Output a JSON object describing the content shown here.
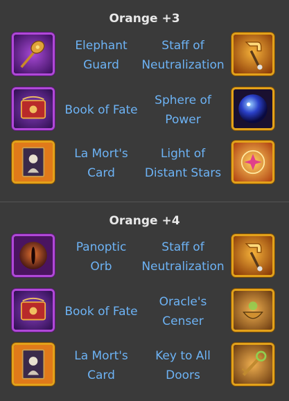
{
  "sections": [
    {
      "title": "Orange +3",
      "rows": [
        {
          "left": {
            "name": "Elephant Guard",
            "line1": "Elephant",
            "line2": "Guard",
            "icon": "elephant-guard-icon",
            "frame": "purple"
          },
          "right": {
            "name": "Staff of Neutralization",
            "line1": "Staff of",
            "line2": "Neutralization",
            "icon": "staff-of-neutralization-icon",
            "frame": "gold"
          }
        },
        {
          "left": {
            "name": "Book of Fate",
            "line1": "Book of Fate",
            "line2": "",
            "icon": "book-of-fate-icon",
            "frame": "purple"
          },
          "right": {
            "name": "Sphere of Power",
            "line1": "Sphere of",
            "line2": "Power",
            "icon": "sphere-of-power-icon",
            "frame": "gold"
          }
        },
        {
          "left": {
            "name": "La Mort's Card",
            "line1": "La Mort's",
            "line2": "Card",
            "icon": "la-morts-card-icon",
            "frame": "gold"
          },
          "right": {
            "name": "Light of Distant Stars",
            "line1": "Light of",
            "line2": "Distant Stars",
            "icon": "light-of-distant-stars-icon",
            "frame": "gold"
          }
        }
      ]
    },
    {
      "title": "Orange +4",
      "rows": [
        {
          "left": {
            "name": "Panoptic Orb",
            "line1": "Panoptic",
            "line2": "Orb",
            "icon": "panoptic-orb-icon",
            "frame": "purple"
          },
          "right": {
            "name": "Staff of Neutralization",
            "line1": "Staff of",
            "line2": "Neutralization",
            "icon": "staff-of-neutralization-icon",
            "frame": "gold"
          }
        },
        {
          "left": {
            "name": "Book of Fate",
            "line1": "Book of Fate",
            "line2": "",
            "icon": "book-of-fate-icon",
            "frame": "purple"
          },
          "right": {
            "name": "Oracle's Censer",
            "line1": "Oracle's",
            "line2": "Censer",
            "icon": "oracles-censer-icon",
            "frame": "gold"
          }
        },
        {
          "left": {
            "name": "La Mort's Card",
            "line1": "La Mort's",
            "line2": "Card",
            "icon": "la-morts-card-icon",
            "frame": "gold"
          },
          "right": {
            "name": "Key to All Doors",
            "line1": "Key to All",
            "line2": "Doors",
            "icon": "key-to-all-doors-icon",
            "frame": "gold"
          }
        }
      ]
    }
  ],
  "colors": {
    "heading": "#e8e8e8",
    "label": "#6db3f5",
    "background": "#3a3a3a",
    "purple_frame": "#b048d8",
    "gold_frame": "#e3a21a"
  }
}
